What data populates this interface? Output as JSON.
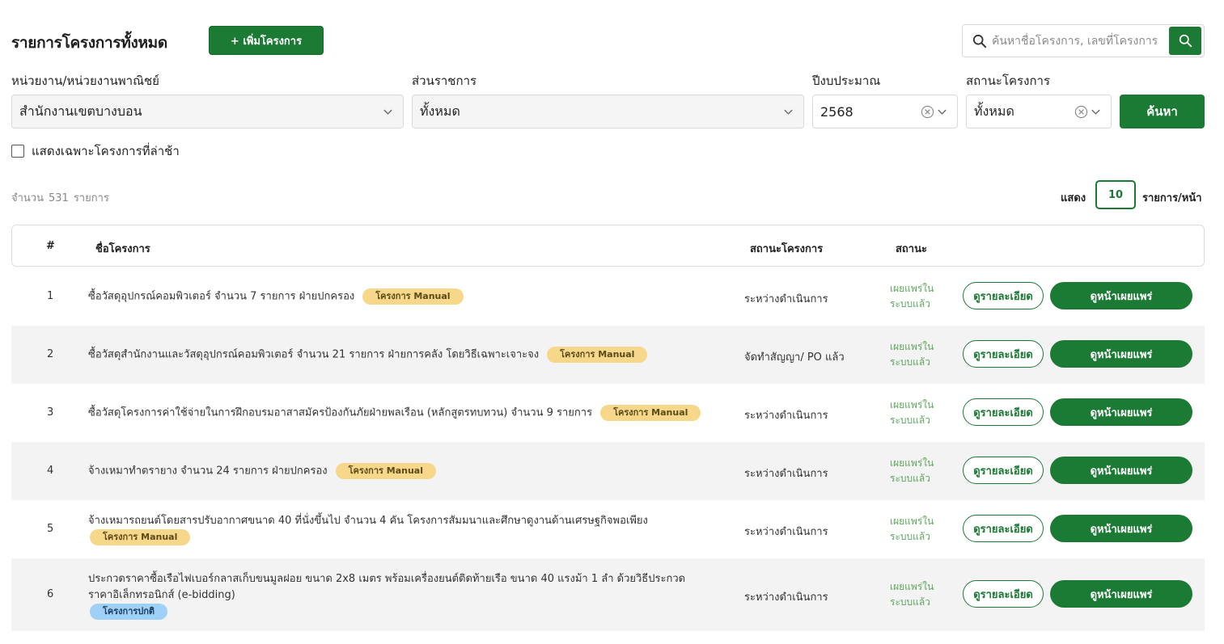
{
  "header": {
    "title": "รายการโครงการทั้งหมด",
    "add_button": "+ เพิ่มโครงการ",
    "search_placeholder": "ค้นหาชื่อโครงการ, เลขที่โครงการ"
  },
  "filters": {
    "agency_label": "หน่วยงาน/หน่วยงานพาณิชย์",
    "agency_value": "สำนักงานเขตบางบอน",
    "division_label": "ส่วนราชการ",
    "division_value": "ทั้งหมด",
    "year_label": "ปีงบประมาณ",
    "year_value": "2568",
    "status_label": "สถานะโครงการ",
    "status_value": "ทั้งหมด",
    "search_button": "ค้นหา",
    "late_only_label": "แสดงเฉพาะโครงการที่ล่าช้า"
  },
  "summary": {
    "count_prefix": "จำนวน",
    "count_value": "531",
    "count_suffix": "รายการ",
    "show_label": "แสดง",
    "per_page": "10",
    "per_page_suffix": "รายการ/หน้า"
  },
  "table": {
    "headers": {
      "num": "#",
      "name": "ชื่อโครงการ",
      "project_status": "สถานะโครงการ",
      "status": "สถานะ"
    },
    "detail_label": "ดูรายละเอียด",
    "publish_label": "ดูหน้าเผยแพร่",
    "rows": [
      {
        "num": "1",
        "name": "ซื้อวัสดุอุปกรณ์คอมพิวเตอร์ จำนวน 7 รายการ ฝ่ายปกครอง",
        "name2": "",
        "tag": "โครงการ Manual",
        "status": "ระหว่างดำเนินการ",
        "pub1": "เผยแพร่ใน",
        "pub2": "ระบบแล้ว"
      },
      {
        "num": "2",
        "name": "ซื้อวัสดุสำนักงานและวัสดุอุปกรณ์คอมพิวเตอร์ จำนวน 21 รายการ ฝ่ายการคลัง โดยวิธีเฉพาะเจาะจง",
        "name2": "",
        "tag": "โครงการ Manual",
        "status": "จัดทำสัญญา/ PO แล้ว",
        "pub1": "เผยแพร่ใน",
        "pub2": "ระบบแล้ว"
      },
      {
        "num": "3",
        "name": "ซื้อวัสดุโครงการค่าใช้จ่ายในการฝึกอบรมอาสาสมัครป้องกันภัยฝ่ายพลเรือน (หลักสูตรทบทวน) จำนวน 9 รายการ",
        "name2": "",
        "tag": "โครงการ Manual",
        "status": "ระหว่างดำเนินการ",
        "pub1": "เผยแพร่ใน",
        "pub2": "ระบบแล้ว"
      },
      {
        "num": "4",
        "name": "จ้างเหมาทำตรายาง จำนวน 24 รายการ ฝ่ายปกครอง",
        "name2": "",
        "tag": "โครงการ Manual",
        "status": "ระหว่างดำเนินการ",
        "pub1": "เผยแพร่ใน",
        "pub2": "ระบบแล้ว"
      },
      {
        "num": "5",
        "name": "จ้างเหมารถยนต์โดยสารปรับอากาศขนาด 40 ที่นั่งขึ้นไป จำนวน 4 คัน โครงการสัมมนาและศึกษาดูงานด้านเศรษฐกิจพอเพียง",
        "name2": "",
        "tag": "โครงการ Manual",
        "status": "ระหว่างดำเนินการ",
        "pub1": "เผยแพร่ใน",
        "pub2": "ระบบแล้ว"
      },
      {
        "num": "6",
        "name": "ประกวดราคาซื้อเรือไฟเบอร์กลาสเก็บขนมูลฝอย ขนาด 2x8 เมตร พร้อมเครื่องยนต์ติดท้ายเรือ ขนาด 40 แรงม้า 1 ลำ ด้วยวิธีประกวด",
        "name2": "ราคาอิเล็กทรอนิกส์ (e-bidding)",
        "tag": "โครงการปกติ",
        "status": "ระหว่างดำเนินการ",
        "pub1": "เผยแพร่ใน",
        "pub2": "ระบบแล้ว"
      }
    ]
  },
  "colors": {
    "primary": "#1b7a34",
    "tag_manual": "#f7d88a",
    "tag_normal": "#9fd0f7",
    "published": "#5da75d"
  }
}
